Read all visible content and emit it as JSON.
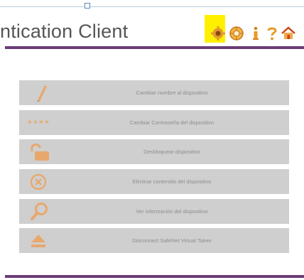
{
  "header": {
    "title": "ntication Client",
    "toolbar_icons": [
      "gear-icon",
      "settings-icon",
      "info-icon",
      "help-icon",
      "home-icon"
    ]
  },
  "menu": {
    "items": [
      {
        "label": "Cambiar nombre al dispositivo",
        "icon": "pencil-icon"
      },
      {
        "label": "Cambiar Contraseña del dispositivo",
        "icon": "password-stars-icon"
      },
      {
        "label": "Desbloquear dispositivo",
        "icon": "unlock-icon"
      },
      {
        "label": "Eliminar contenido del dispositivo",
        "icon": "delete-icon"
      },
      {
        "label": "Ver información del dispositivo",
        "icon": "search-icon"
      },
      {
        "label": "Disconnect SafeNet Virtual Token",
        "icon": "eject-icon"
      }
    ]
  },
  "colors": {
    "accent_orange": "#e7a86e",
    "purple_rule": "#6a3c76",
    "highlight": "#fff000",
    "row_bg": "#cfcfcf"
  }
}
